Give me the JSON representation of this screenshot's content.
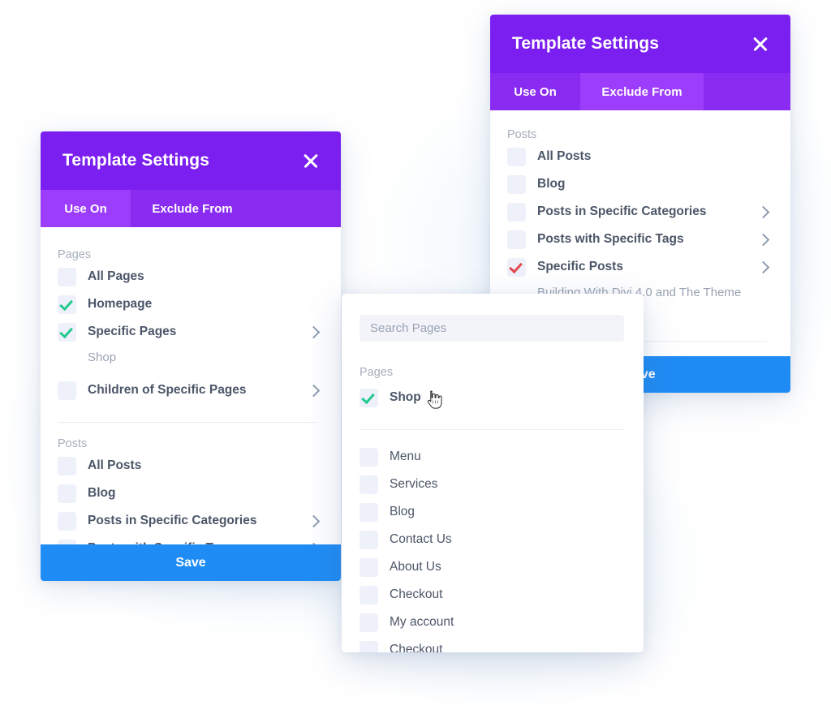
{
  "window": {
    "title": "Template Settings",
    "close_icon": "close-icon",
    "save_label": "Save"
  },
  "tabs": {
    "use_on": "Use On",
    "exclude_from": "Exclude From"
  },
  "panel_use_on": {
    "title": "Template Settings",
    "active_tab": "Use On",
    "sections": [
      {
        "label": "Pages",
        "rows": [
          {
            "label": "All Pages",
            "checked": false,
            "check_color": "",
            "chevron": false,
            "sub": ""
          },
          {
            "label": "Homepage",
            "checked": true,
            "check_color": "#22c98e",
            "chevron": false,
            "sub": ""
          },
          {
            "label": "Specific Pages",
            "checked": true,
            "check_color": "#22c98e",
            "chevron": true,
            "sub": "Shop"
          },
          {
            "label": "Children of Specific Pages",
            "checked": false,
            "check_color": "",
            "chevron": true,
            "sub": ""
          }
        ]
      },
      {
        "label": "Posts",
        "rows": [
          {
            "label": "All Posts",
            "checked": false,
            "check_color": "",
            "chevron": false,
            "sub": ""
          },
          {
            "label": "Blog",
            "checked": false,
            "check_color": "",
            "chevron": false,
            "sub": ""
          },
          {
            "label": "Posts in Specific Categories",
            "checked": false,
            "check_color": "",
            "chevron": true,
            "sub": ""
          },
          {
            "label": "Posts with Specific Tags",
            "checked": false,
            "check_color": "",
            "chevron": true,
            "sub": ""
          }
        ]
      }
    ]
  },
  "panel_exclude_from": {
    "title": "Template Settings",
    "active_tab": "Exclude From",
    "sections": [
      {
        "label": "Posts",
        "rows": [
          {
            "label": "All Posts",
            "checked": false,
            "check_color": "",
            "chevron": false,
            "sub": ""
          },
          {
            "label": "Blog",
            "checked": false,
            "check_color": "",
            "chevron": false,
            "sub": ""
          },
          {
            "label": "Posts in Specific Categories",
            "checked": false,
            "check_color": "",
            "chevron": true,
            "sub": ""
          },
          {
            "label": "Posts with Specific Tags",
            "checked": false,
            "check_color": "",
            "chevron": true,
            "sub": ""
          },
          {
            "label": "Specific Posts",
            "checked": true,
            "check_color": "#e4474f",
            "chevron": true,
            "sub": "Building With Divi 4.0 and The Theme"
          }
        ]
      }
    ]
  },
  "panel_search": {
    "search_placeholder": "Search Pages",
    "search_value": "",
    "selected_section_label": "Pages",
    "selected_rows": [
      {
        "label": "Shop",
        "checked": true,
        "check_color": "#22c98e"
      }
    ],
    "available_rows": [
      {
        "label": "Menu",
        "checked": false
      },
      {
        "label": "Services",
        "checked": false
      },
      {
        "label": "Blog",
        "checked": false
      },
      {
        "label": "Contact Us",
        "checked": false
      },
      {
        "label": "About Us",
        "checked": false
      },
      {
        "label": "Checkout",
        "checked": false
      },
      {
        "label": "My account",
        "checked": false
      },
      {
        "label": "Checkout",
        "checked": false
      }
    ],
    "cursor_icon": "pointing-hand-cursor"
  },
  "colors": {
    "header_purple": "#7b1ff0",
    "tab_bar_purple": "#8a2bf2",
    "tab_active_purple": "#9b3dfb",
    "accent_blue": "#1f8cf5",
    "check_green": "#22c98e",
    "check_red": "#e4474f",
    "label_text": "#4c5668",
    "muted_text": "#9aa3b3",
    "checkbox_bg": "#eef0fa"
  }
}
